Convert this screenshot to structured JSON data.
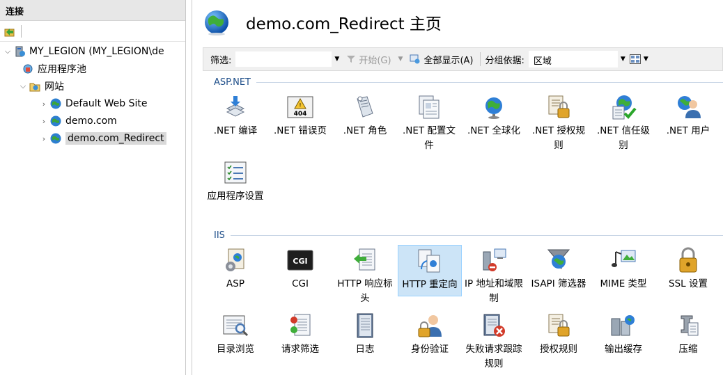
{
  "left_pane": {
    "header": "连接",
    "tree": [
      {
        "label": "MY_LEGION (MY_LEGION\\de",
        "icon": "server-icon"
      },
      {
        "label": "应用程序池",
        "icon": "app-pools-icon"
      },
      {
        "label": "网站",
        "icon": "sites-folder-icon"
      },
      {
        "label": "Default Web Site",
        "icon": "website-globe-icon"
      },
      {
        "label": "demo.com",
        "icon": "website-globe-icon"
      },
      {
        "label": "demo.com_Redirect",
        "icon": "website-globe-icon"
      }
    ]
  },
  "main": {
    "title": "demo.com_Redirect 主页",
    "filterbar": {
      "filter_label": "筛选:",
      "filter_value": "",
      "start_label": "开始(G)",
      "show_all_label": "全部显示(A)",
      "group_label": "分组依据:",
      "group_value": "区域"
    },
    "sections": [
      {
        "title": "ASP.NET"
      },
      {
        "title": "IIS"
      }
    ],
    "features": [
      {
        "label": ".NET 编译",
        "icon": "net-compile-icon"
      },
      {
        "label": ".NET 错误页",
        "icon": "error-page-404-icon"
      },
      {
        "label": ".NET 角色",
        "icon": "net-roles-icon"
      },
      {
        "label": ".NET 配置文件",
        "icon": "net-profile-icon"
      },
      {
        "label": ".NET 全球化",
        "icon": "globalization-icon"
      },
      {
        "label": ".NET 授权规则",
        "icon": "authorization-lock-icon"
      },
      {
        "label": ".NET 信任级别",
        "icon": "trust-level-icon"
      },
      {
        "label": ".NET 用户",
        "icon": "net-users-icon"
      },
      {
        "label": "应用程序设置",
        "icon": "app-settings-icon"
      },
      {
        "label": "ASP",
        "icon": "asp-icon"
      },
      {
        "label": "CGI",
        "icon": "cgi-icon"
      },
      {
        "label": "HTTP 响应标头",
        "icon": "http-headers-icon"
      },
      {
        "label": "HTTP 重定向",
        "icon": "http-redirect-icon"
      },
      {
        "label": "IP 地址和域限制",
        "icon": "ip-restrictions-icon"
      },
      {
        "label": "ISAPI 筛选器",
        "icon": "isapi-filter-icon"
      },
      {
        "label": "MIME 类型",
        "icon": "mime-types-icon"
      },
      {
        "label": "SSL 设置",
        "icon": "ssl-lock-icon"
      },
      {
        "label": "目录浏览",
        "icon": "directory-browse-icon"
      },
      {
        "label": "请求筛选",
        "icon": "request-filter-icon"
      },
      {
        "label": "日志",
        "icon": "logging-icon"
      },
      {
        "label": "身份验证",
        "icon": "authentication-icon"
      },
      {
        "label": "失败请求跟踪规则",
        "icon": "failed-request-icon"
      },
      {
        "label": "授权规则",
        "icon": "authorization-rules-icon"
      },
      {
        "label": "输出缓存",
        "icon": "output-cache-icon"
      },
      {
        "label": "压缩",
        "icon": "compression-icon"
      }
    ]
  }
}
